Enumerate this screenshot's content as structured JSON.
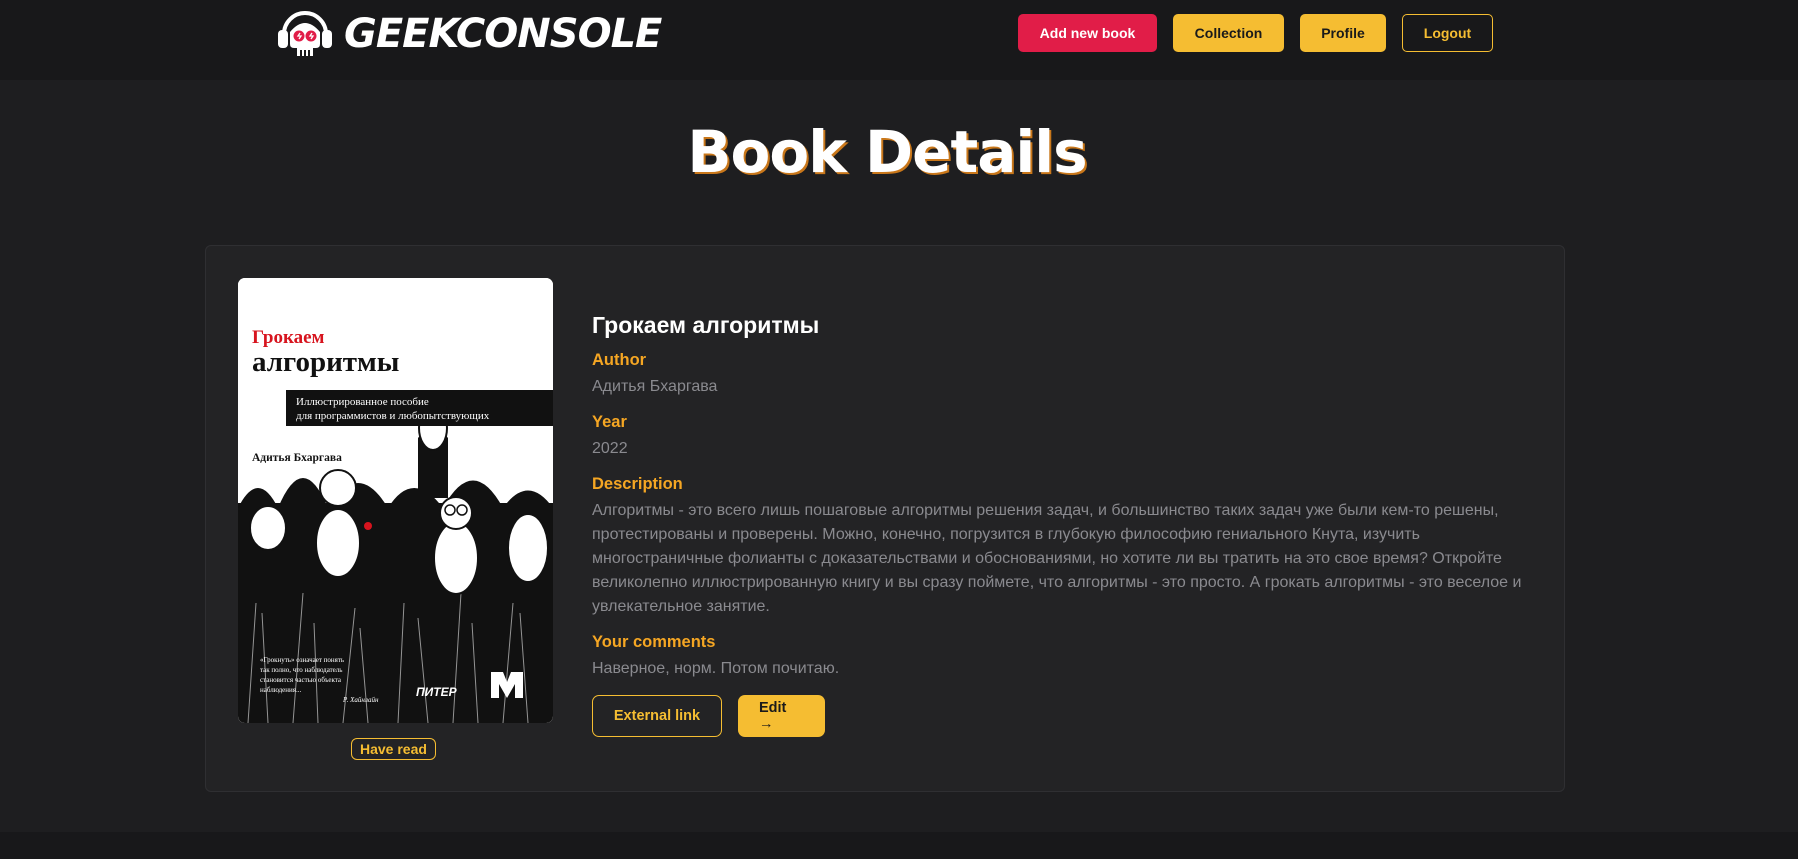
{
  "brand": {
    "name": "GEEKCONSOLE"
  },
  "nav": {
    "add_book": "Add new book",
    "collection": "Collection",
    "profile": "Profile",
    "logout": "Logout"
  },
  "page": {
    "title": "Book Details"
  },
  "book": {
    "title": "Грокаем алгоритмы",
    "author_label": "Author",
    "author": "Адитья Бхаргава",
    "year_label": "Year",
    "year": "2022",
    "description_label": "Description",
    "description": "Алгоритмы - это всего лишь пошаговые алгоритмы решения задач, и большинство таких задач уже были кем-то решены, протестированы и проверены. Можно, конечно, погрузится в глубокую философию гениального Кнута, изучить многостраничные фолианты с доказательствами и обоснованиями, но хотите ли вы тратить на это свое время? Откройте великолепно иллюстрированную книгу и вы сразу поймете, что алгоритмы - это просто. А грокать алгоритмы - это веселое и увлекательное занятие.",
    "comments_label": "Your comments",
    "comments": "Наверное, норм. Потом почитаю.",
    "status_badge": "Have read",
    "cover": {
      "title_line1": "Грокаем",
      "title_line2": "алгоритмы",
      "subtitle_line1": "Иллюстрированное пособие",
      "subtitle_line2": "для программистов и любопытствующих",
      "author": "Адитья Бхаргава",
      "quote_line1": "«Грокнуть» означает понять",
      "quote_line2": "так полно, что наблюдатель",
      "quote_line3": "становится частью объекта",
      "quote_line4": "наблюдения...",
      "quote_author": "Р. Хайнлайн",
      "publisher": "ПИТЕР"
    }
  },
  "actions": {
    "external_link": "External link",
    "edit": "Edit →"
  },
  "colors": {
    "accent": "#f5bd32",
    "danger": "#e11d48",
    "label": "#f5a623"
  }
}
